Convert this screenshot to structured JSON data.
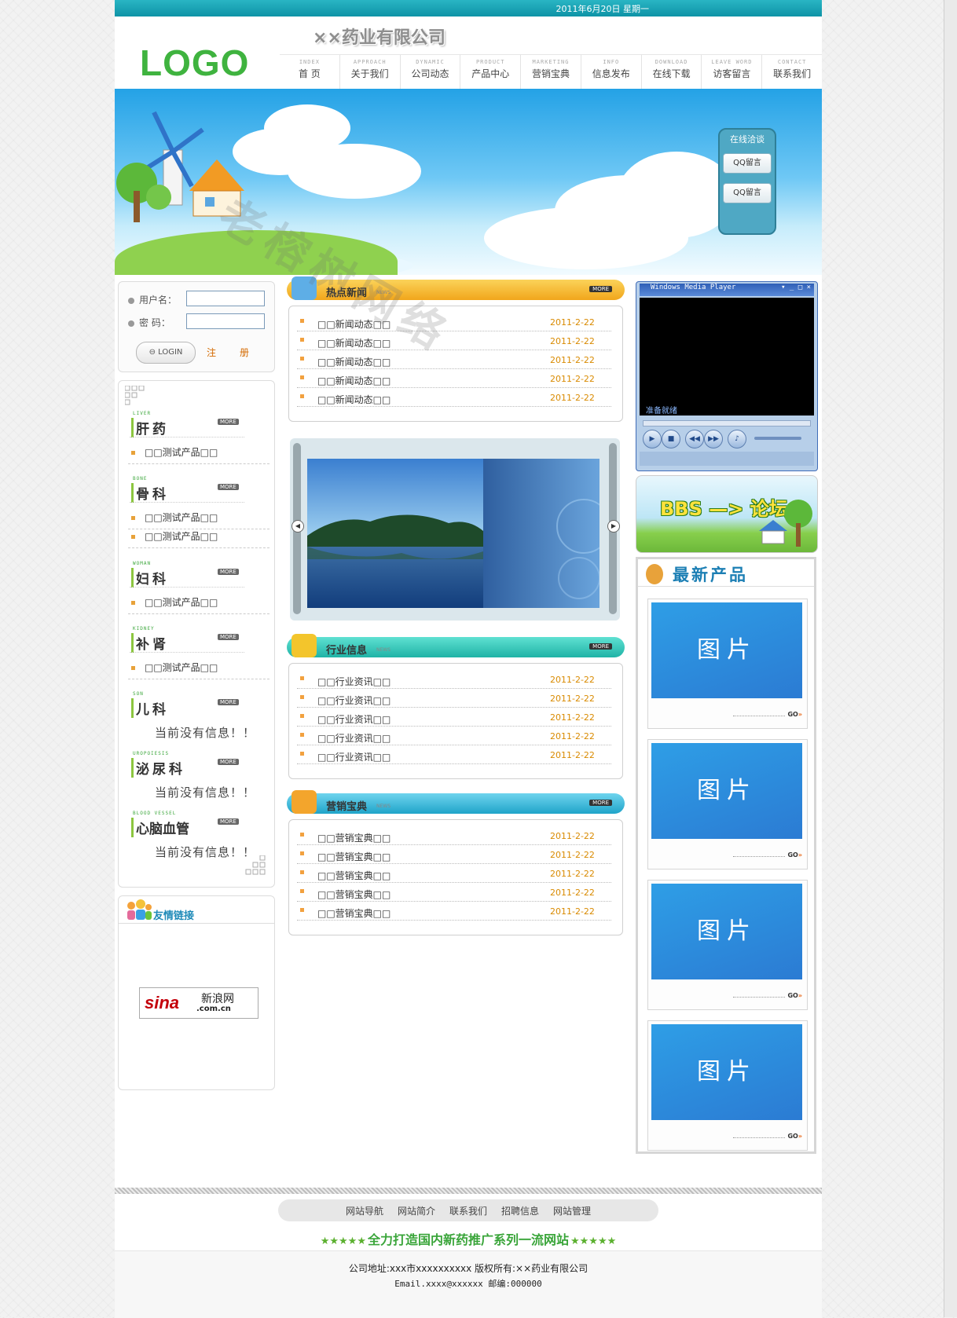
{
  "header": {
    "date": "2011年6月20日  星期一",
    "logo": "LOGO",
    "company": "××药业有限公司"
  },
  "nav": [
    {
      "en": "INDEX",
      "cn": "首  页"
    },
    {
      "en": "APPROACH",
      "cn": "关于我们"
    },
    {
      "en": "DYNAMIC",
      "cn": "公司动态"
    },
    {
      "en": "PRODUCT",
      "cn": "产品中心"
    },
    {
      "en": "MARKETING",
      "cn": "营销宝典"
    },
    {
      "en": "INFO",
      "cn": "信息发布"
    },
    {
      "en": "DOWNLOAD",
      "cn": "在线下载"
    },
    {
      "en": "LEAVE WORD",
      "cn": "访客留言"
    },
    {
      "en": "CONTACT",
      "cn": "联系我们"
    }
  ],
  "chat": {
    "title": "在线洽谈",
    "btn1": "QQ留言",
    "btn2": "QQ留言"
  },
  "login": {
    "user_label": "用户名：",
    "pass_label": "密  码：",
    "login_btn": "LOGIN",
    "register": "注册"
  },
  "categories": [
    {
      "en": "LIVER",
      "cn": "肝药",
      "more": "MORE",
      "items": [
        "□□测试产品□□"
      ]
    },
    {
      "en": "BONE",
      "cn": "骨科",
      "more": "MORE",
      "items": [
        "□□测试产品□□",
        "□□测试产品□□"
      ]
    },
    {
      "en": "WOMAN",
      "cn": "妇科",
      "more": "MORE",
      "items": [
        "□□测试产品□□"
      ]
    },
    {
      "en": "KIDNEY",
      "cn": "补肾",
      "more": "MORE",
      "items": [
        "□□测试产品□□"
      ]
    },
    {
      "en": "SON",
      "cn": "儿科",
      "more": "MORE",
      "empty": "当前没有信息！！"
    },
    {
      "en": "UROPOIESIS",
      "cn": "泌尿科",
      "more": "MORE",
      "empty": "当前没有信息！！"
    },
    {
      "en": "BLOOD VESSEL",
      "cn": "心脑血管",
      "more": "MORE",
      "empty": "当前没有信息！！"
    }
  ],
  "links": {
    "title": "友情链接",
    "sina_logo": "sina",
    "sina_cn": "新浪网",
    "sina_url": ".com.cn"
  },
  "sections": {
    "hot": {
      "title": "热点新闻",
      "en": "NEWS",
      "more": "MORE",
      "rows": [
        {
          "title": "□□新闻动态□□",
          "date": "2011-2-22"
        },
        {
          "title": "□□新闻动态□□",
          "date": "2011-2-22"
        },
        {
          "title": "□□新闻动态□□",
          "date": "2011-2-22"
        },
        {
          "title": "□□新闻动态□□",
          "date": "2011-2-22"
        },
        {
          "title": "□□新闻动态□□",
          "date": "2011-2-22"
        }
      ]
    },
    "industry": {
      "title": "行业信息",
      "en": "NEWS",
      "more": "MORE",
      "rows": [
        {
          "title": "□□行业资讯□□",
          "date": "2011-2-22"
        },
        {
          "title": "□□行业资讯□□",
          "date": "2011-2-22"
        },
        {
          "title": "□□行业资讯□□",
          "date": "2011-2-22"
        },
        {
          "title": "□□行业资讯□□",
          "date": "2011-2-22"
        },
        {
          "title": "□□行业资讯□□",
          "date": "2011-2-22"
        }
      ]
    },
    "marketing": {
      "title": "营销宝典",
      "en": "NEWS",
      "more": "MORE",
      "rows": [
        {
          "title": "□□营销宝典□□",
          "date": "2011-2-22"
        },
        {
          "title": "□□营销宝典□□",
          "date": "2011-2-22"
        },
        {
          "title": "□□营销宝典□□",
          "date": "2011-2-22"
        },
        {
          "title": "□□营销宝典□□",
          "date": "2011-2-22"
        },
        {
          "title": "□□营销宝典□□",
          "date": "2011-2-22"
        }
      ]
    }
  },
  "player": {
    "title": "Windows Media Player",
    "status": "准备就绪"
  },
  "bbs": {
    "text": "BBS —> 论坛"
  },
  "new_products": {
    "title": "最新产品",
    "items": [
      {
        "img": "图片",
        "go": "GO"
      },
      {
        "img": "图片",
        "go": "GO"
      },
      {
        "img": "图片",
        "go": "GO"
      },
      {
        "img": "图片",
        "go": "GO"
      }
    ]
  },
  "footer": {
    "nav": [
      "网站导航",
      "网站简介",
      "联系我们",
      "招聘信息",
      "网站管理"
    ],
    "slogan": "全力打造国内新药推广系列一流网站",
    "address": "公司地址:xxx市xxxxxxxxxx 版权所有:××药业有限公司",
    "email": "Email.xxxx@xxxxxx 邮编:000000"
  },
  "watermark": "老榕树网络",
  "colors": {
    "accent": "#1398a9",
    "logo_green": "#3fb33f",
    "date_orange": "#d98a00",
    "product_blue": "#2b8fe0"
  }
}
